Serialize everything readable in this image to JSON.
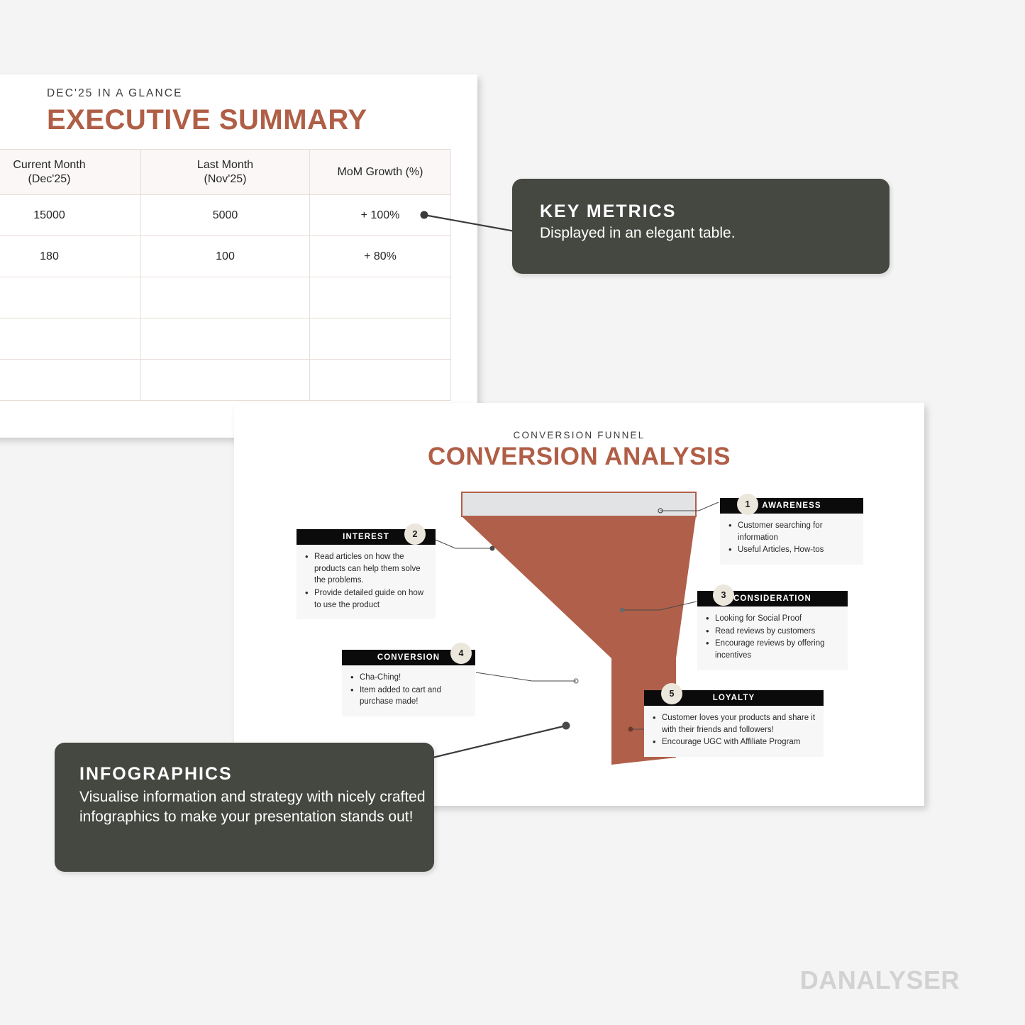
{
  "page": {
    "background_color": "#f4f4f4",
    "accent_color": "#b05e46",
    "callout_bg": "#454741",
    "watermark": "DANALYSER"
  },
  "exec_slide": {
    "eyebrow": "DEC'25 IN A GLANCE",
    "title": "EXECUTIVE SUMMARY",
    "table": {
      "headers": [
        "Current Month\n(Dec'25)",
        "Last Month\n(Nov'25)",
        "MoM Growth (%)"
      ],
      "header_line1": [
        "Current Month",
        "Last Month",
        "MoM Growth (%)"
      ],
      "header_line2": [
        "(Dec'25)",
        "(Nov'25)",
        ""
      ],
      "rows": [
        [
          "15000",
          "5000",
          "+ 100%"
        ],
        [
          "180",
          "100",
          "+ 80%"
        ],
        [
          "",
          "",
          ""
        ],
        [
          "",
          "",
          ""
        ],
        [
          "",
          "",
          ""
        ]
      ]
    }
  },
  "funnel_slide": {
    "eyebrow": "CONVERSION FUNNEL",
    "title": "CONVERSION ANALYSIS",
    "steps": [
      {
        "number": "1",
        "label": "AWARENESS",
        "bullets": [
          "Customer searching for information",
          "Useful Articles, How-tos"
        ]
      },
      {
        "number": "2",
        "label": "INTEREST",
        "bullets": [
          "Read articles on how the products can help them solve the problems.",
          "Provide detailed guide on how to use the product"
        ]
      },
      {
        "number": "3",
        "label": "CONSIDERATION",
        "bullets": [
          "Looking for Social Proof",
          "Read reviews by customers",
          "Encourage reviews by offering incentives"
        ]
      },
      {
        "number": "4",
        "label": "CONVERSION",
        "bullets": [
          "Cha-Ching!",
          "Item added to cart and purchase made!"
        ]
      },
      {
        "number": "5",
        "label": "LOYALTY",
        "bullets": [
          "Customer loves your products and share it with their friends and followers!",
          "Encourage UGC with Affiliate Program"
        ]
      }
    ],
    "funnel_colors": {
      "body": "#b0604a",
      "top_band": "#e2e3e5",
      "border": "#b0604a"
    }
  },
  "callouts": [
    {
      "title": "KEY METRICS",
      "body": "Displayed in an elegant table."
    },
    {
      "title": "INFOGRAPHICS",
      "body": "Visualise information and strategy with nicely crafted infographics to make your presentation stands out!"
    }
  ]
}
